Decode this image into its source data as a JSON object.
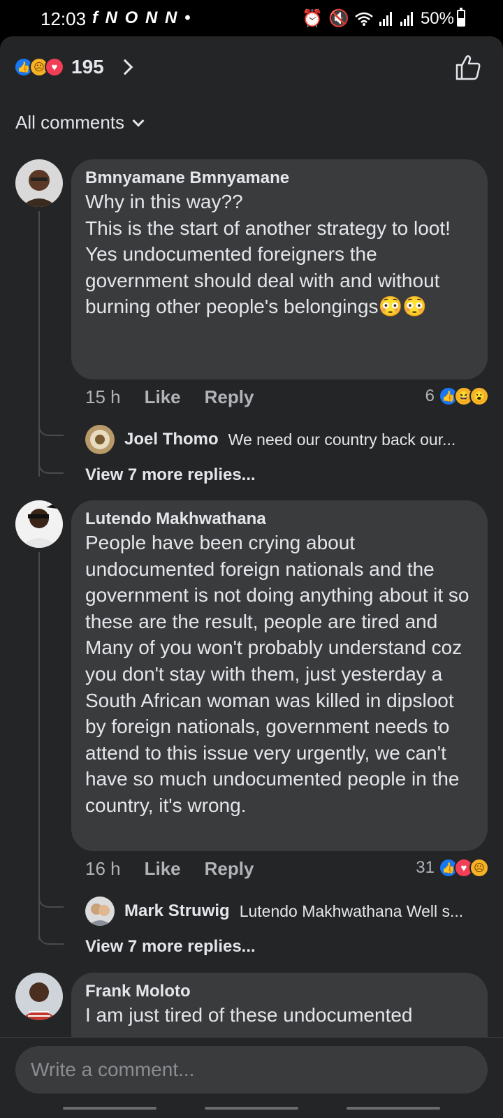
{
  "status_bar": {
    "time": "12:03",
    "notification_glyphs": "f N O N N •",
    "battery": "50%"
  },
  "header": {
    "reaction_count": "195",
    "reactions": [
      "like",
      "sad",
      "love"
    ]
  },
  "sort": {
    "label": "All comments"
  },
  "comments": [
    {
      "author": "Bmnyamane Bmnyamane",
      "text": "Why in this way??\nThis is the start of another strategy to loot!\nYes undocumented foreigners the government should deal with and without burning other people's belongings😳😳",
      "time": "15 h",
      "like_label": "Like",
      "reply_label": "Reply",
      "reaction_count": "6",
      "reactions": [
        "like",
        "haha",
        "wow"
      ],
      "reply_preview": {
        "author": "Joel Thomo",
        "text": "We need our country back our..."
      },
      "view_more": "View 7 more replies..."
    },
    {
      "author": "Lutendo Makhwathana",
      "text": "People have been crying about undocumented foreign nationals and the government is not doing anything about it so these are the result, people are tired and Many of you won't probably understand coz you don't stay with them, just yesterday a South African woman was killed in dipsloot by foreign nationals, government needs to attend to this issue very urgently, we can't have so much undocumented people in the country, it's wrong.",
      "time": "16 h",
      "like_label": "Like",
      "reply_label": "Reply",
      "reaction_count": "31",
      "reactions": [
        "like",
        "love",
        "sad"
      ],
      "reply_preview": {
        "author": "Mark Struwig",
        "text": "Lutendo Makhwathana Well s..."
      },
      "view_more": "View 7 more replies..."
    },
    {
      "author": "Frank Moloto",
      "text": "I am just tired of these undocumented"
    }
  ],
  "composer": {
    "placeholder": "Write a comment..."
  },
  "colors": {
    "panel": "#242526",
    "bubble": "#3a3b3c",
    "like_blue": "#1877f2",
    "love_red": "#f33e58",
    "emoji_yellow": "#f7b125",
    "secondary_text": "#b0b3b8"
  }
}
